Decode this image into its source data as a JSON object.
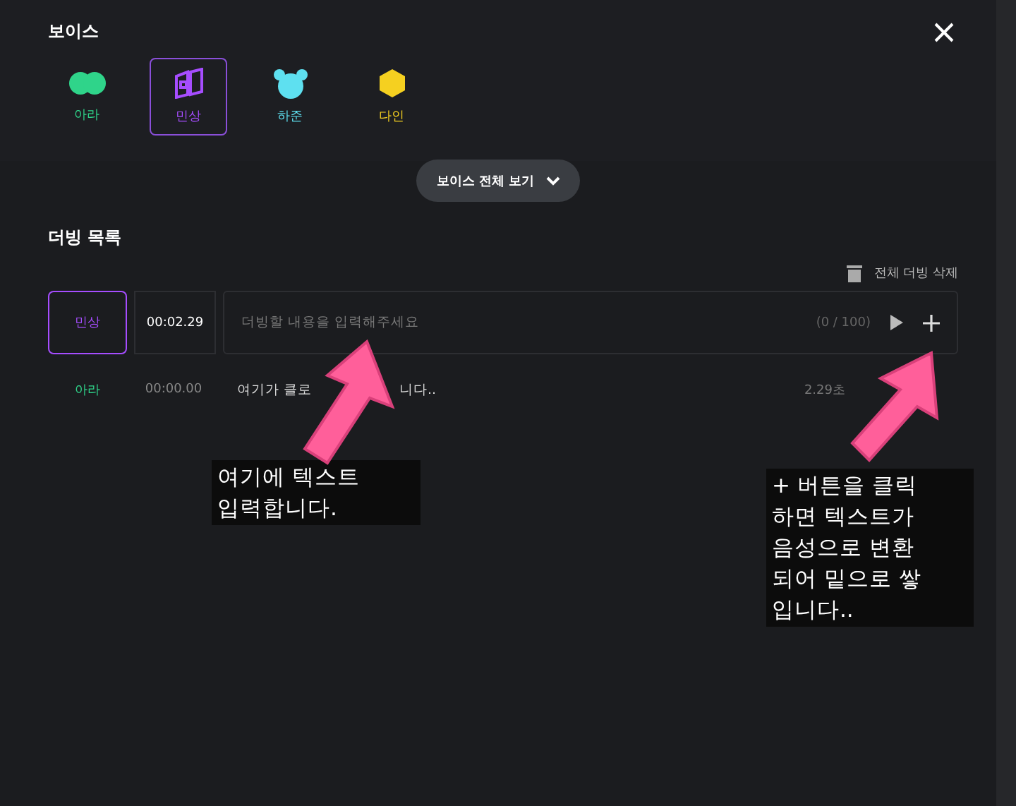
{
  "dialog": {
    "title": "보이스"
  },
  "voices": [
    {
      "name": "아라",
      "color": "#2fd48a",
      "kind": "clover",
      "selected": false
    },
    {
      "name": "민상",
      "color": "#a64dff",
      "kind": "book",
      "selected": true
    },
    {
      "name": "하준",
      "color": "#5ee0f0",
      "kind": "bear",
      "selected": false
    },
    {
      "name": "다인",
      "color": "#f5d020",
      "kind": "hexagon",
      "selected": false
    }
  ],
  "view_all_button": "보이스 전체 보기",
  "dubbing": {
    "title": "더빙 목록",
    "delete_all": "전체 더빙 삭제",
    "input_row": {
      "voice": "민상",
      "color": "#a64dff",
      "time": "00:02.29",
      "placeholder": "더빙할 내용을 입력해주세요",
      "counter": "(0 / 100)"
    },
    "items": [
      {
        "voice": "아라",
        "color": "#2fd48a",
        "time": "00:00.00",
        "text_parts": [
          "여기가 클로",
          "니다.."
        ],
        "duration": "2.29초"
      }
    ]
  },
  "annotations": [
    {
      "lines": [
        "여기에 텍스트",
        "입력합니다."
      ]
    },
    {
      "lines": [
        "+ 버튼을 클릭",
        "하면 텍스트가",
        "음성으로 변환",
        "되어 밑으로 쌓",
        "입니다.."
      ]
    }
  ]
}
